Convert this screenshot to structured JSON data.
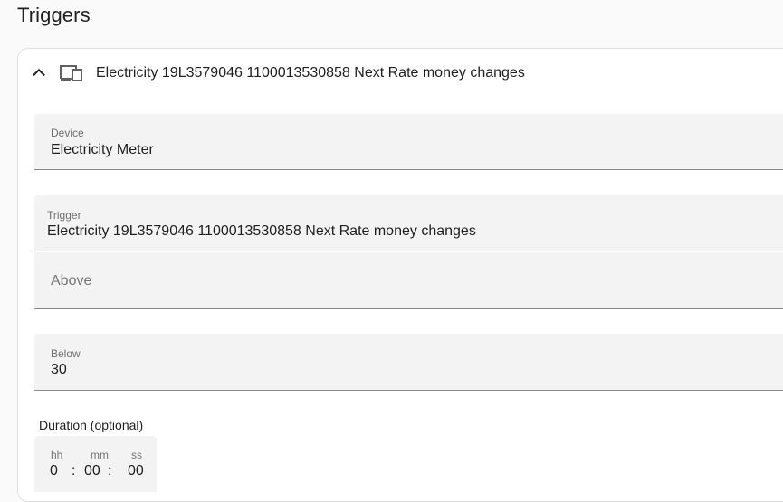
{
  "page": {
    "title": "Triggers"
  },
  "trigger_card": {
    "title": "Electricity 19L3579046 1100013530858 Next Rate money changes",
    "icons": {
      "collapse": "chevron-up-icon",
      "device": "devices-icon"
    },
    "device_field": {
      "label": "Device",
      "value": "Electricity Meter"
    },
    "trigger_field": {
      "label": "Trigger",
      "value": "Electricity 19L3579046 1100013530858 Next Rate money changes"
    },
    "above_field": {
      "placeholder": "Above",
      "value": ""
    },
    "below_field": {
      "label": "Below",
      "value": "30"
    },
    "duration": {
      "label": "Duration (optional)",
      "hours_label": "hh",
      "minutes_label": "mm",
      "seconds_label": "ss",
      "hours": "0",
      "minutes": "00",
      "seconds": "00",
      "separator": ":"
    }
  },
  "colors": {
    "field_bg": "#f3f3f3",
    "field_underline": "#8c8c8c",
    "label_text": "#6f6f6f",
    "card_border": "#e0e0e0"
  }
}
